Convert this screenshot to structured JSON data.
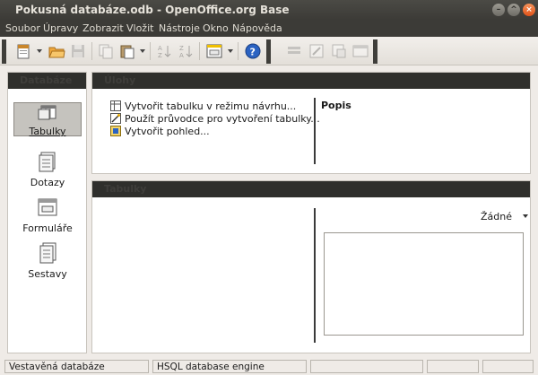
{
  "window": {
    "title": "Pokusná databáze.odb - OpenOffice.org Base"
  },
  "menu": [
    {
      "label": "Soubor"
    },
    {
      "label": "Úpravy"
    },
    {
      "label": "Zobrazit"
    },
    {
      "label": "Vložit"
    },
    {
      "label": "Nástroje"
    },
    {
      "label": "Okno"
    },
    {
      "label": "Nápověda"
    }
  ],
  "toolbar": {
    "icons": [
      "new-document-icon",
      "open-folder-icon",
      "save-icon",
      "copy-icon",
      "paste-icon",
      "sort-ascending-icon",
      "sort-descending-icon",
      "form-icon",
      "help-icon",
      "query-icon",
      "edit-icon",
      "rename-icon",
      "delete-icon"
    ]
  },
  "sidebar": {
    "header": "Databáze",
    "items": [
      {
        "label": "Tabulky",
        "icon": "tables-icon",
        "selected": true
      },
      {
        "label": "Dotazy",
        "icon": "queries-icon"
      },
      {
        "label": "Formuláře",
        "icon": "forms-icon"
      },
      {
        "label": "Sestavy",
        "icon": "reports-icon"
      }
    ]
  },
  "tasks_panel": {
    "header": "Úlohy",
    "items": [
      {
        "label": "Vytvořit tabulku v režimu návrhu...",
        "icon": "design-table-icon"
      },
      {
        "label": "Použít průvodce pro vytvoření tabulky...",
        "icon": "wizard-icon"
      },
      {
        "label": "Vytvořit pohled...",
        "icon": "view-icon"
      }
    ],
    "description_label": "Popis"
  },
  "tables_panel": {
    "header": "Tabulky",
    "preview_select": "Žádné"
  },
  "statusbar": {
    "cells": [
      "Vestavěná databáze",
      "HSQL database engine",
      "",
      "",
      ""
    ]
  }
}
